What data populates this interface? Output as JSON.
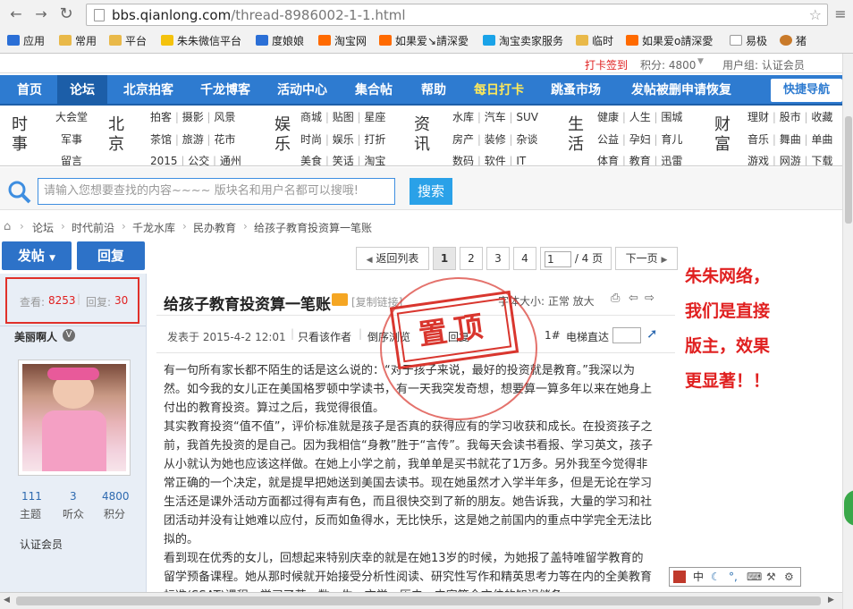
{
  "browser": {
    "url_host": "bbs.qianlong.com",
    "url_path": "/thread-8986002-1-1.html",
    "bookmarks": [
      "应用",
      "常用",
      "平台",
      "朱朱微信平台",
      "度娘娘",
      "淘宝网",
      "如果爱↘請深愛",
      "淘宝卖家服务",
      "临时",
      "如果爱o請深愛",
      "易极",
      "猪"
    ]
  },
  "userbar": {
    "checkin": "打卡签到",
    "points": "积分: 4800",
    "group": "用户组: 认证会员"
  },
  "nav": [
    "首页",
    "论坛",
    "北京拍客",
    "千龙博客",
    "活动中心",
    "集合帖",
    "帮助",
    "每日打卡",
    "跳蚤市场",
    "发帖被删申请恢复"
  ],
  "quick_nav": "快捷导航",
  "categories": [
    {
      "head": "时事",
      "items": [
        [
          "大会堂"
        ],
        [
          "军事"
        ],
        [
          "留言"
        ]
      ]
    },
    {
      "head": "北京",
      "items": [
        [
          "拍客",
          "摄影",
          "风景"
        ],
        [
          "茶馆",
          "旅游",
          "花市"
        ],
        [
          "2015",
          "公交",
          "通州"
        ]
      ]
    },
    {
      "head": "娱乐",
      "items": [
        [
          "商城",
          "贴图",
          "星座"
        ],
        [
          "时尚",
          "娱乐",
          "打折"
        ],
        [
          "美食",
          "笑话",
          "淘宝"
        ]
      ]
    },
    {
      "head": "资讯",
      "items": [
        [
          "水库",
          "汽车",
          "SUV"
        ],
        [
          "房产",
          "装修",
          "杂谈"
        ],
        [
          "数码",
          "软件",
          "IT"
        ]
      ]
    },
    {
      "head": "生活",
      "items": [
        [
          "健康",
          "人生",
          "围城"
        ],
        [
          "公益",
          "孕妇",
          "育儿"
        ],
        [
          "体育",
          "教育",
          "迅雷"
        ]
      ]
    },
    {
      "head": "财富",
      "items": [
        [
          "理财",
          "股市",
          "收藏"
        ],
        [
          "音乐",
          "舞曲",
          "单曲"
        ],
        [
          "游戏",
          "网游",
          "下载"
        ]
      ]
    }
  ],
  "search": {
    "placeholder": "请输入您想要查找的内容~~~~ 版块名和用户名都可以搜哦!",
    "button": "搜索"
  },
  "breadcrumb": [
    "论坛",
    "时代前沿",
    "千龙水库",
    "民办教育",
    "给孩子教育投资算一笔账"
  ],
  "actions": {
    "post": "发帖",
    "reply": "回复"
  },
  "pager": {
    "back": "返回列表",
    "pages": [
      "1",
      "2",
      "3",
      "4"
    ],
    "current": "1",
    "total": "/ 4 页",
    "next": "下一页"
  },
  "stats": {
    "views_label": "查看:",
    "views": "8253",
    "replies_label": "回复:",
    "replies": "30"
  },
  "author": {
    "name": "美丽啊人",
    "badge": "V",
    "topics": "111",
    "topics_label": "主题",
    "fans": "3",
    "fans_label": "听众",
    "score": "4800",
    "score_label": "积分",
    "group": "认证会员"
  },
  "thread": {
    "title": "给孩子教育投资算一笔账",
    "copy_link": "[复制链接]",
    "font_size": "字体大小: 正常 放大",
    "posted": "发表于 2015-4-2 12:01",
    "only_author": "只看该作者",
    "reverse": "倒序浏览",
    "reply_to": "回复",
    "floor": "1#",
    "elevator": "电梯直达",
    "stamp": "置顶",
    "paragraphs": [
      "有一句所有家长都不陌生的话是这么说的：“对于孩子来说，最好的投资就是教育。”我深以为然。如今我的女儿正在美国格罗顿中学读书，有一天我突发奇想，想要算一算多年以来在她身上付出的教育投资。算过之后，我觉得很值。",
      "其实教育投资“值不值”，评价标准就是孩子是否真的获得应有的学习收获和成长。在投资孩子之前，我首先投资的是自己。因为我相信“身教”胜于“言传”。我每天会读书看报、学习英文，孩子从小就认为她也应该这样做。在她上小学之前，我单单是买书就花了1万多。另外我至今觉得非常正确的一个决定，就是提早把她送到美国去读书。现在她虽然才入学半年多，但是无论在学习生活还是课外活动方面都过得有声有色，而且很快交到了新的朋友。她告诉我，大量的学习和社团活动并没有让她难以应付，反而如鱼得水，无比快乐，这是她之前国内的重点中学完全无法比拟的。",
      "看到现在优秀的女儿，回想起来特别庆幸的就是在她13岁的时候，为她报了盖特唯留学教育的留学预备课程。她从那时候就开始接受分析性阅读、研究性写作和精英思考力等在内的全美教育标准(SSAT)课程，学习了英、数、生、文学、历史，内容等全方位的知识储备，"
    ]
  },
  "annotation": [
    "朱朱网络，",
    "我们是直接",
    "版主，效果",
    "更显著！！"
  ],
  "ime": "中"
}
